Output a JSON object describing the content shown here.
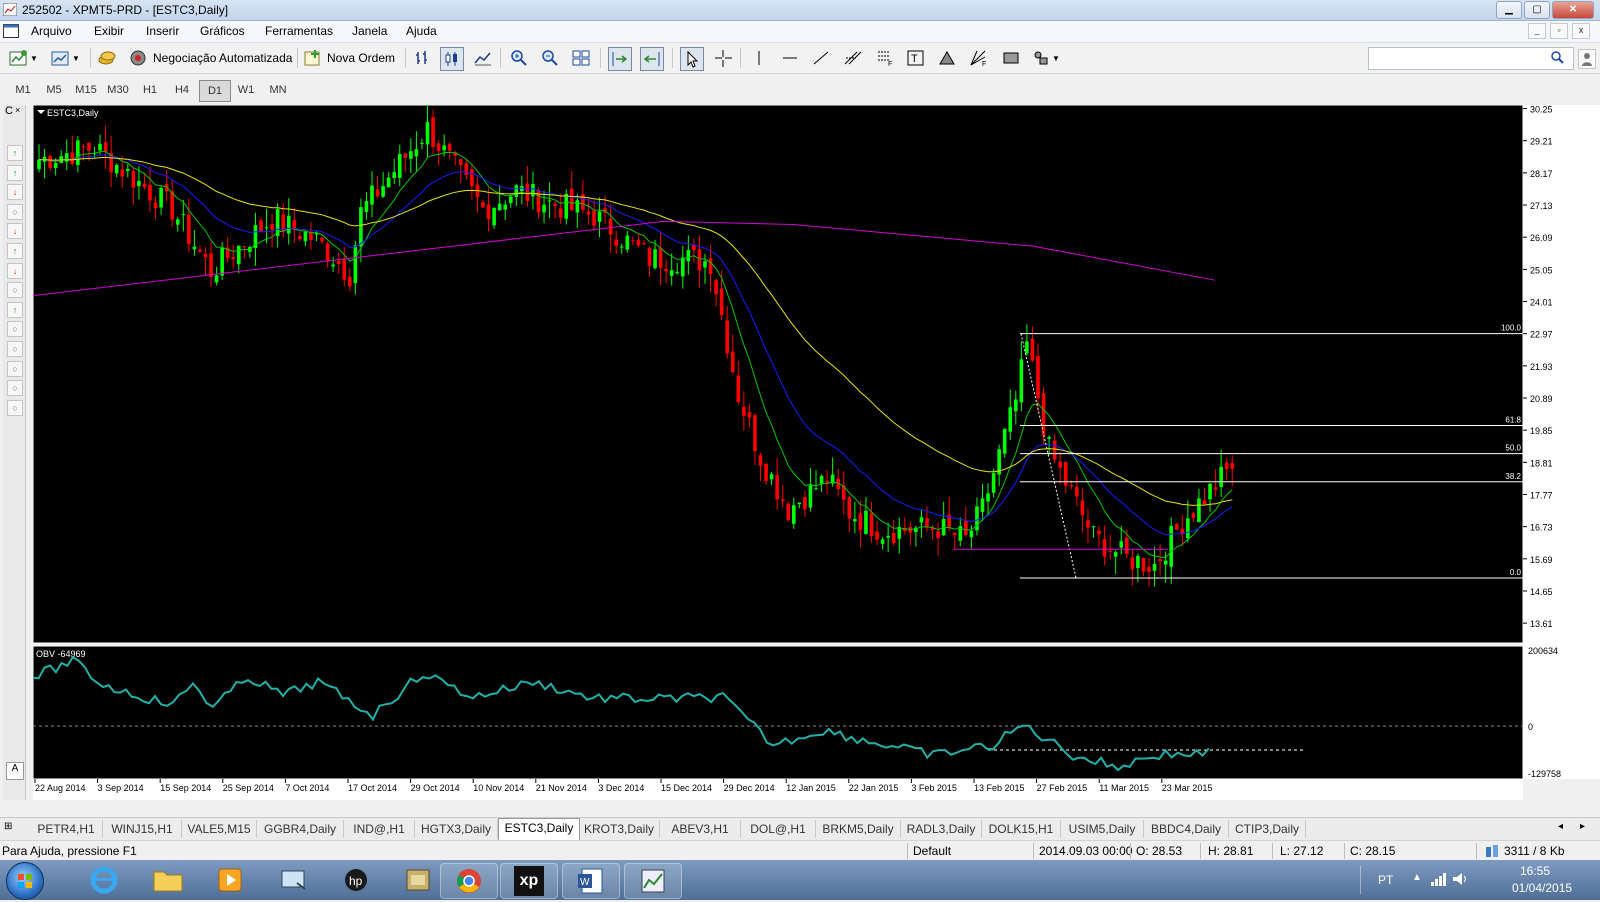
{
  "window": {
    "title": "252502 - XPMT5-PRD - [ESTC3,Daily]",
    "min_label": "▁",
    "max_label": "▢",
    "close_label": "✕"
  },
  "menu": {
    "items": [
      "Arquivo",
      "Exibir",
      "Inserir",
      "Gráficos",
      "Ferramentas",
      "Janela",
      "Ajuda"
    ]
  },
  "toolbar": {
    "auto_trading_label": "Negociação Automatizada",
    "new_order_label": "Nova Ordem",
    "search_placeholder": ""
  },
  "timeframes": {
    "items": [
      "M1",
      "M5",
      "M15",
      "M30",
      "H1",
      "H4",
      "D1",
      "W1",
      "MN"
    ],
    "active": "D1"
  },
  "chart": {
    "label": "ESTC3,Daily",
    "price_ticks": [
      "30.25",
      "29.21",
      "28.17",
      "27.13",
      "26.09",
      "25.05",
      "24.01",
      "22.97",
      "21.93",
      "20.89",
      "19.85",
      "18.81",
      "17.77",
      "16.73",
      "15.69",
      "14.65",
      "13.61"
    ],
    "fib_levels": [
      {
        "label": "100.0",
        "price": 22.97
      },
      {
        "label": "61.8",
        "price": 20.0
      },
      {
        "label": "50.0",
        "price": 19.09
      },
      {
        "label": "38.2",
        "price": 18.18
      },
      {
        "label": "0.0",
        "price": 15.07
      }
    ],
    "price_range": [
      13.0,
      30.3
    ],
    "date_labels": [
      "22 Aug 2014",
      "3 Sep 2014",
      "15 Sep 2014",
      "25 Sep 2014",
      "7 Oct 2014",
      "17 Oct 2014",
      "29 Oct 2014",
      "10 Nov 2014",
      "21 Nov 2014",
      "3 Dec 2014",
      "15 Dec 2014",
      "29 Dec 2014",
      "12 Jan 2015",
      "22 Jan 2015",
      "3 Feb 2015",
      "13 Feb 2015",
      "27 Feb 2015",
      "11 Mar 2015",
      "23 Mar 2015"
    ],
    "obv_label": "OBV -64969",
    "obv_ticks": [
      "200634",
      "0",
      "-129758"
    ],
    "colors": {
      "bull": "#00ff00",
      "bear": "#ff0000",
      "ma_fast": "#00c800",
      "ma_mid": "#1a1aff",
      "ma_slow": "#e6e600",
      "ma_long": "#d400d4",
      "obv": "#20b2aa",
      "fib": "#ffffff",
      "bg": "#000000"
    }
  },
  "tabs": {
    "items": [
      "PETR4,H1",
      "WINJ15,H1",
      "VALE5,M15",
      "GGBR4,Daily",
      "IND@,H1",
      "HGTX3,Daily",
      "ESTC3,Daily",
      "KROT3,Daily",
      "ABEV3,H1",
      "DOL@,H1",
      "BRKM5,Daily",
      "RADL3,Daily",
      "DOLK15,H1",
      "USIM5,Daily",
      "BBDC4,Daily",
      "CTIP3,Daily"
    ],
    "active": "ESTC3,Daily"
  },
  "status": {
    "help": "Para Ajuda, pressione F1",
    "profile": "Default",
    "datetime": "2014.09.03 00:00",
    "open": "O: 28.53",
    "high": "H: 28.81",
    "low": "L: 27.12",
    "close": "C: 28.15",
    "traffic": "3311 / 8 Kb"
  },
  "taskbar": {
    "lang": "PT",
    "time": "16:55",
    "date": "01/04/2015",
    "apps": [
      "ie-icon",
      "folder-icon",
      "media-icon",
      "network-icon",
      "hp-icon",
      "archive-icon",
      "chrome-icon",
      "xp-icon",
      "word-icon",
      "metatrader-icon"
    ],
    "xp_label": "xp"
  }
}
